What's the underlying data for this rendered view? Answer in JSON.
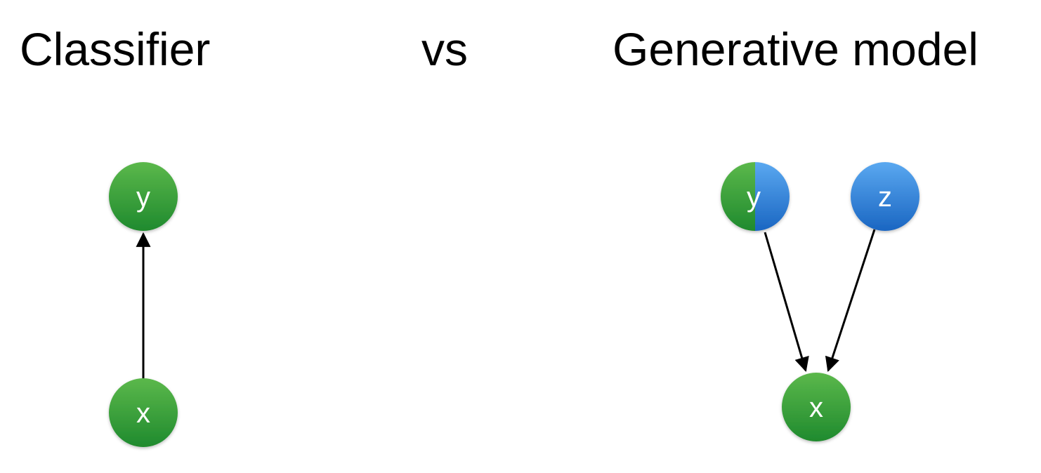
{
  "titles": {
    "left": "Classifier",
    "middle": "vs",
    "right": "Generative model"
  },
  "classifier": {
    "nodes": {
      "y": "y",
      "x": "x"
    }
  },
  "generative": {
    "nodes": {
      "y": "y",
      "z": "z",
      "x": "x"
    }
  },
  "colors": {
    "green_light": "#5bb84b",
    "green_dark": "#1f8a2e",
    "blue_light": "#5aa8f0",
    "blue_dark": "#1a66c2",
    "edge": "#000000",
    "label": "#ffffff"
  }
}
